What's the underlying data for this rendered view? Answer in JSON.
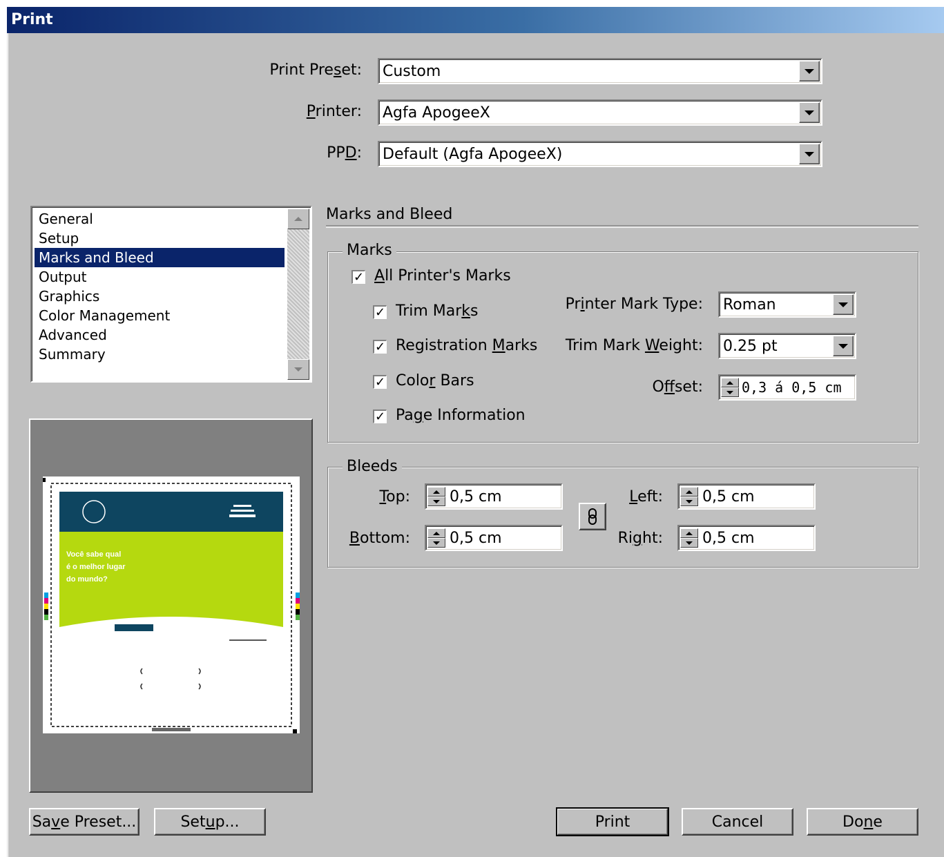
{
  "window": {
    "title": "Print"
  },
  "top_fields": {
    "print_preset": {
      "label": "Print Preset:",
      "value": "Custom"
    },
    "printer": {
      "label": "Printer:",
      "value": "Agfa ApogeeX"
    },
    "ppd": {
      "label": "PPD:",
      "value": "Default (Agfa ApogeeX)"
    }
  },
  "categories": {
    "items": [
      "General",
      "Setup",
      "Marks and Bleed",
      "Output",
      "Graphics",
      "Color Management",
      "Advanced",
      "Summary"
    ],
    "selected": "Marks and Bleed"
  },
  "panel": {
    "title": "Marks and Bleed"
  },
  "marks": {
    "group_title": "Marks",
    "all_printers_marks": {
      "label": "All Printer's Marks",
      "checked": true
    },
    "trim_marks": {
      "label": "Trim Marks",
      "checked": true
    },
    "registration_marks": {
      "label": "Registration Marks",
      "checked": true
    },
    "color_bars": {
      "label": "Color Bars",
      "checked": true
    },
    "page_information": {
      "label": "Page Information",
      "checked": true
    },
    "printer_mark_type": {
      "label": "Printer Mark Type:",
      "value": "Roman"
    },
    "trim_mark_weight": {
      "label": "Trim Mark Weight:",
      "value": "0.25 pt"
    },
    "offset": {
      "label": "Offset:",
      "value": "0,3 á 0,5 cm"
    }
  },
  "bleeds": {
    "group_title": "Bleeds",
    "top": {
      "label": "Top:",
      "value": "0,5 cm"
    },
    "bottom": {
      "label": "Bottom:",
      "value": "0,5 cm"
    },
    "left": {
      "label": "Left:",
      "value": "0,5 cm"
    },
    "right": {
      "label": "Right:",
      "value": "0,5 cm"
    }
  },
  "preview": {
    "headline": [
      "Você sabe qual",
      "é o melhor lugar",
      "do mundo?"
    ],
    "colors": {
      "header": "#0e4560",
      "green": "#b5d90f"
    }
  },
  "buttons": {
    "save_preset": "Save Preset...",
    "setup": "Setup...",
    "print": "Print",
    "cancel": "Cancel",
    "done": "Done"
  },
  "icons": {
    "chain": "chain-link-icon",
    "checkmark": "✓"
  }
}
